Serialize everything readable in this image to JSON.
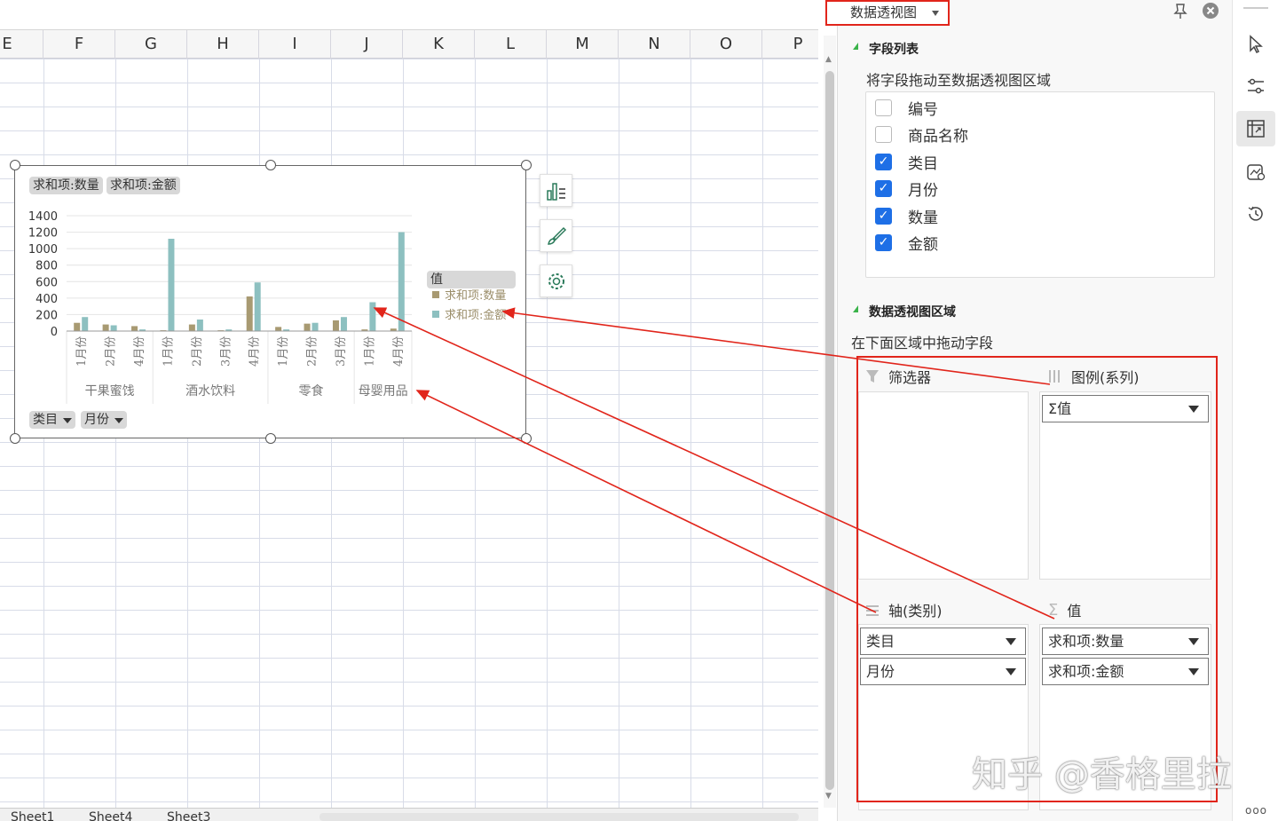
{
  "sheet": {
    "columns": [
      "E",
      "F",
      "G",
      "H",
      "I",
      "J",
      "K",
      "L",
      "M",
      "N",
      "O",
      "P"
    ],
    "tabs": [
      "Sheet1",
      "Sheet4",
      "Sheet3"
    ]
  },
  "chart": {
    "pills_top": [
      "求和项:数量",
      "求和项:金额"
    ],
    "pills_bottom": [
      "类目",
      "月份"
    ],
    "legend_title": "值"
  },
  "chart_data": {
    "type": "bar",
    "ylim": [
      0,
      1400
    ],
    "yticks": [
      0,
      200,
      400,
      600,
      800,
      1000,
      1200,
      1400
    ],
    "groups": [
      {
        "name": "干果蜜饯",
        "categories": [
          "1月份",
          "2月份",
          "4月份"
        ]
      },
      {
        "name": "酒水饮料",
        "categories": [
          "1月份",
          "2月份",
          "3月份",
          "4月份"
        ]
      },
      {
        "name": "零食",
        "categories": [
          "1月份",
          "2月份",
          "3月份"
        ]
      },
      {
        "name": "母婴用品",
        "categories": [
          "1月份",
          "4月份"
        ]
      }
    ],
    "series": [
      {
        "name": "求和项:数量",
        "color": "#a89a72",
        "values": [
          100,
          80,
          60,
          10,
          80,
          10,
          420,
          50,
          90,
          130,
          20,
          30
        ]
      },
      {
        "name": "求和项:金额",
        "color": "#8dc0c0",
        "values": [
          170,
          70,
          20,
          1120,
          140,
          20,
          590,
          20,
          100,
          170,
          350,
          1200
        ]
      }
    ]
  },
  "panel": {
    "header": "数据透视图",
    "field_list_title": "字段列表",
    "field_list_hint": "将字段拖动至数据透视图区域",
    "fields": [
      {
        "label": "编号",
        "checked": false
      },
      {
        "label": "商品名称",
        "checked": false
      },
      {
        "label": "类目",
        "checked": true
      },
      {
        "label": "月份",
        "checked": true
      },
      {
        "label": "数量",
        "checked": true
      },
      {
        "label": "金额",
        "checked": true
      }
    ],
    "area_title": "数据透视图区域",
    "area_hint": "在下面区域中拖动字段",
    "filter_label": "筛选器",
    "legend_label": "图例(系列)",
    "legend_items": [
      "Σ值"
    ],
    "axis_label": "轴(类别)",
    "axis_items": [
      "类目",
      "月份"
    ],
    "values_label": "值",
    "values_items": [
      "求和项:数量",
      "求和项:金额"
    ]
  },
  "toolbar": {
    "icons": [
      "select-icon",
      "settings-sliders-icon",
      "pivot-icon",
      "chart-style-icon",
      "history-icon",
      "more-icon"
    ],
    "more": "ooo"
  },
  "accent": "#e1251b",
  "watermark": "知乎 @香格里拉"
}
